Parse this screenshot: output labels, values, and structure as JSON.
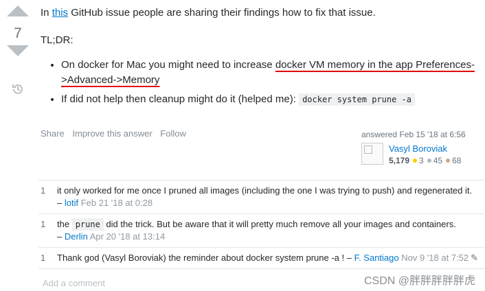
{
  "vote": {
    "count": "7"
  },
  "post": {
    "intro_pre": "In ",
    "intro_link": "this",
    "intro_post": " GitHub issue people are sharing their findings how to fix that issue.",
    "tldr": "TL;DR:",
    "bullet1_pre": "On docker for Mac you might need to increase ",
    "bullet1_highlight": "docker VM memory in the app Preferences->Advanced->Memory",
    "bullet2_pre": "If did not help then cleanup might do it (helped me): ",
    "bullet2_code": "docker system prune -a"
  },
  "actions": {
    "share": "Share",
    "improve": "Improve this answer",
    "follow": "Follow"
  },
  "user": {
    "asked": "answered Feb 15 '18 at 6:56",
    "name": "Vasyl Boroviak",
    "rep": "5,179",
    "gold": "3",
    "silver": "45",
    "bronze": "68",
    "colors": {
      "gold": "#ffcc01",
      "silver": "#b4b8bc",
      "bronze": "#d1a684"
    }
  },
  "comments": [
    {
      "score": "1",
      "text": "it only worked for me once I pruned all images (including the one I was trying to push) and regenerated it.",
      "user": "lotif",
      "date": "Feb 21 '18 at 0:28"
    },
    {
      "score": "1",
      "pre": "the ",
      "code": "prune",
      "text": " did the trick. But be aware that it will pretty much remove all your images and containers.",
      "user": "Derlin",
      "date": "Apr 20 '18 at 13:14"
    },
    {
      "score": "1",
      "text": "Thank god (Vasyl Boroviak) the reminder about docker system prune -a ! – ",
      "user": "F. Santiago",
      "date": "Nov 9 '18 at 7:52"
    }
  ],
  "add_comment": "Add a comment",
  "watermark": "CSDN @胖胖胖胖胖虎",
  "icons": [
    "upvote-arrow-icon",
    "downvote-arrow-icon",
    "history-icon",
    "pencil-icon"
  ]
}
